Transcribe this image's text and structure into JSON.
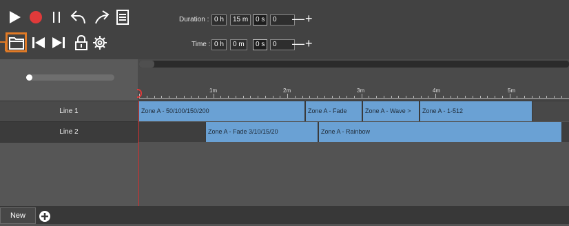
{
  "toolbar": {
    "duration": {
      "label": "Duration :",
      "h": "0 h",
      "m": "15 m",
      "s": "0 s",
      "f": "0"
    },
    "time": {
      "label": "Time :",
      "h": "0 h",
      "m": "0 m",
      "s": "0 s",
      "f": "0"
    },
    "minus": "—",
    "plus": "+"
  },
  "ruler": {
    "ticks": [
      "1m",
      "2m",
      "3m",
      "4m",
      "5m"
    ]
  },
  "tracks": [
    {
      "label": "Line 1",
      "clips": [
        "Zone A - 50/100/150/200",
        "Zone A - Fade",
        "Zone A - Wave >",
        "Zone A - 1-512"
      ]
    },
    {
      "label": "Line 2",
      "clips": [
        "Zone A - Fade 3/10/15/20",
        "Zone A - Rainbow"
      ]
    }
  ],
  "tabs": {
    "new_label": "New"
  },
  "colors": {
    "accent_highlight": "#e07a26",
    "record": "#e03a3a",
    "clip": "#6aa1d4",
    "playhead": "#d43030"
  }
}
